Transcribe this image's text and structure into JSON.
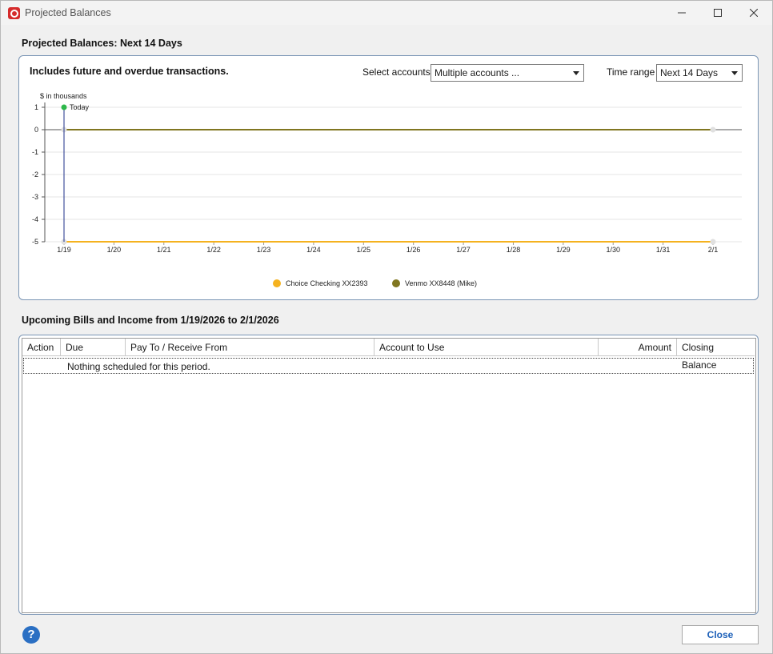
{
  "window": {
    "title": "Projected Balances",
    "app_icon": "quicken-q-icon"
  },
  "header": {
    "section_title": "Projected Balances: Next 14 Days"
  },
  "chart_panel": {
    "note": "Includes future and overdue transactions.",
    "select_accounts_label": "Select accounts",
    "select_accounts_value": "Multiple accounts ...",
    "time_range_label": "Time range",
    "time_range_value": "Next 14 Days"
  },
  "chart_data": {
    "type": "line",
    "y_unit_label": "$ in thousands",
    "today_label": "Today",
    "categories": [
      "1/19",
      "1/20",
      "1/21",
      "1/22",
      "1/23",
      "1/24",
      "1/25",
      "1/26",
      "1/27",
      "1/28",
      "1/29",
      "1/30",
      "1/31",
      "2/1"
    ],
    "yticks": [
      "1",
      "0",
      "-1",
      "-2",
      "-3",
      "-4",
      "-5"
    ],
    "ylim": [
      -5,
      1
    ],
    "grid": true,
    "legend_position": "bottom",
    "series": [
      {
        "name": "Choice Checking XX2393",
        "color": "#f5b21f",
        "values": [
          -5,
          -5,
          -5,
          -5,
          -5,
          -5,
          -5,
          -5,
          -5,
          -5,
          -5,
          -5,
          -5,
          -5
        ]
      },
      {
        "name": "Venmo XX8448 (Mike)",
        "color": "#807620",
        "values": [
          0,
          0,
          0,
          0,
          0,
          0,
          0,
          0,
          0,
          0,
          0,
          0,
          0,
          0
        ]
      }
    ]
  },
  "upcoming": {
    "section_title": "Upcoming Bills and Income from 1/19/2026 to 2/1/2026",
    "columns": [
      "Action",
      "Due",
      "Pay To / Receive From",
      "Account to Use",
      "Amount",
      "Closing Balance"
    ],
    "empty_message": "Nothing scheduled for this period."
  },
  "footer": {
    "help_label": "?",
    "close_label": "Close"
  },
  "colors": {
    "accent": "#1b5fb8",
    "panel_border": "#7a95b5",
    "today_marker": "#2eb84b"
  }
}
